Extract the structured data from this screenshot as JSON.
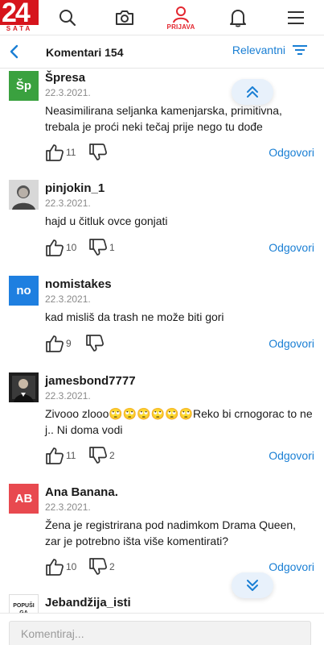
{
  "header": {
    "logo_number": "24",
    "logo_sub": "SATA",
    "login_label": "PRIJAVA",
    "accent": "#e3262f",
    "link_color": "#1a7fd4"
  },
  "subheader": {
    "title": "Komentari 154",
    "sort_label": "Relevantni"
  },
  "comments": [
    {
      "username": "Špresa",
      "avatar_text": "Šp",
      "avatar_color": "#3aa13f",
      "date": "22.3.2021.",
      "text": "Neasimilirana seljanka kamenjarska, primitivna, trebala je proći neki tečaj prije nego tu dođe",
      "likes": "11",
      "dislikes": "",
      "reply_label": "Odgovori"
    },
    {
      "username": "pinjokin_1",
      "avatar_text": "",
      "avatar_color": "#c9c9c9",
      "date": "22.3.2021.",
      "text": "hajd u čitluk ovce gonjati",
      "likes": "10",
      "dislikes": "1",
      "reply_label": "Odgovori"
    },
    {
      "username": "nomistakes",
      "avatar_text": "no",
      "avatar_color": "#1e7fe0",
      "date": "22.3.2021.",
      "text": "kad misliš da trash ne može biti gori",
      "likes": "9",
      "dislikes": "",
      "reply_label": "Odgovori"
    },
    {
      "username": "jamesbond7777",
      "avatar_text": "",
      "avatar_color": "#2a2a2a",
      "date": "22.3.2021.",
      "text": "Zivooo zlooo🙄🙄🙄🙄🙄🙄Reko bi crnogorac to ne j.. Ni doma vodi",
      "likes": "11",
      "dislikes": "2",
      "reply_label": "Odgovori"
    },
    {
      "username": "Ana Banana.",
      "avatar_text": "AB",
      "avatar_color": "#e8494f",
      "date": "22.3.2021.",
      "text": "Žena je registrirana pod nadimkom Drama Queen, zar je potrebno išta više komentirati?",
      "likes": "10",
      "dislikes": "2",
      "reply_label": "Odgovori"
    },
    {
      "username": "Jebandžija_isti",
      "avatar_text": "POPUŠI GA",
      "avatar_color": "#ffffff",
      "date": "",
      "text": "",
      "likes": "",
      "dislikes": "",
      "reply_label": ""
    }
  ],
  "composer": {
    "placeholder": "Komentiraj..."
  }
}
